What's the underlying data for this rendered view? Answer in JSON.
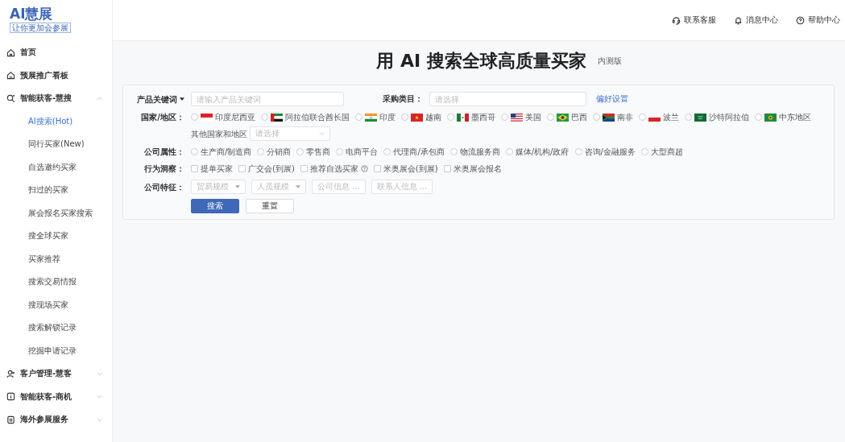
{
  "logo": {
    "title": "AI慧展",
    "tagline": "让你更加会参展"
  },
  "header_links": [
    {
      "kind": "headset",
      "label": "联系客服"
    },
    {
      "kind": "bell",
      "label": "消息中心"
    },
    {
      "kind": "help",
      "label": "帮助中心"
    }
  ],
  "sidebar": {
    "items": [
      {
        "kind": "home",
        "label": "首页"
      },
      {
        "kind": "board",
        "label": "预展推广看板"
      },
      {
        "kind": "search",
        "label": "智能获客-慧搜",
        "expanded": true,
        "children": [
          {
            "label": "AI搜索(Hot)",
            "selected": true
          },
          {
            "label": "同行买家(New)",
            "selected": false
          },
          {
            "label": "自选邀约买家",
            "selected": false
          },
          {
            "label": "扫过的买家",
            "selected": false
          },
          {
            "label": "展会报名买家搜索",
            "selected": false
          },
          {
            "label": "搜全球买家",
            "selected": false
          },
          {
            "label": "买家推荐",
            "selected": false
          },
          {
            "label": "搜索交易情报",
            "selected": false
          },
          {
            "label": "搜现场买家",
            "selected": false
          },
          {
            "label": "搜索解锁记录",
            "selected": false
          },
          {
            "label": "挖掘申请记录",
            "selected": false
          }
        ]
      },
      {
        "kind": "user",
        "label": "客户管理-慧客",
        "expanded": false
      },
      {
        "kind": "info",
        "label": "智能获客-商机",
        "expanded": false
      },
      {
        "kind": "doc",
        "label": "海外参展服务",
        "expanded": false
      }
    ]
  },
  "page": {
    "title": "用 AI 搜索全球高质量买家",
    "badge": "内测版"
  },
  "form": {
    "keyword": {
      "label": "产品关键词",
      "placeholder": "请输入产品关键词"
    },
    "category": {
      "label": "采购类目：",
      "placeholder": "请选择"
    },
    "preference_link": "偏好设置",
    "country": {
      "label": "国家/地区：",
      "options": [
        {
          "label": "印度尼西亚",
          "kind": "indonesia",
          "checked": false
        },
        {
          "label": "阿拉伯联合酋长国",
          "kind": "uae",
          "checked": false
        },
        {
          "label": "印度",
          "kind": "india",
          "checked": false
        },
        {
          "label": "越南",
          "kind": "vietnam",
          "checked": false
        },
        {
          "label": "墨西哥",
          "kind": "mexico",
          "checked": false
        },
        {
          "label": "美国",
          "kind": "usa",
          "checked": false
        },
        {
          "label": "巴西",
          "kind": "brazil",
          "checked": false
        },
        {
          "label": "南非",
          "kind": "southafrica",
          "checked": false
        },
        {
          "label": "波兰",
          "kind": "poland",
          "checked": false
        },
        {
          "label": "沙特阿拉伯",
          "kind": "saudi",
          "checked": false
        },
        {
          "label": "中东地区",
          "kind": "mideast",
          "checked": false
        }
      ],
      "other_label": "其他国家和地区",
      "other_placeholder": "请选择"
    },
    "company_type": {
      "label": "公司属性：",
      "options": [
        {
          "label": "生产商/制造商",
          "checked": false
        },
        {
          "label": "分销商",
          "checked": false
        },
        {
          "label": "零售商",
          "checked": false
        },
        {
          "label": "电商平台",
          "checked": false
        },
        {
          "label": "代理商/承包商",
          "checked": false
        },
        {
          "label": "物流服务商",
          "checked": false
        },
        {
          "label": "媒体/机构/政府",
          "checked": false
        },
        {
          "label": "咨询/金融服务",
          "checked": false
        },
        {
          "label": "大型商超",
          "checked": false
        }
      ]
    },
    "behavior": {
      "label": "行为洞察：",
      "options": [
        {
          "label": "提单买家",
          "checked": false
        },
        {
          "label": "广交会(到展)",
          "checked": false
        },
        {
          "label": "推荐自选买家",
          "checked": false,
          "help": true
        },
        {
          "label": "米奥展会(到展)",
          "checked": false
        },
        {
          "label": "米奥展会报名",
          "checked": false
        }
      ]
    },
    "features": {
      "label": "公司特征：",
      "fields": [
        {
          "kind": "select",
          "placeholder": "贸易规模"
        },
        {
          "kind": "select",
          "placeholder": "人员规模"
        },
        {
          "kind": "more",
          "placeholder": "公司信息 ..."
        },
        {
          "kind": "more",
          "placeholder": "联系人信息 ..."
        }
      ]
    },
    "buttons": [
      {
        "kind": "primary",
        "label": "搜索"
      },
      {
        "kind": "default",
        "label": "重置"
      }
    ]
  }
}
